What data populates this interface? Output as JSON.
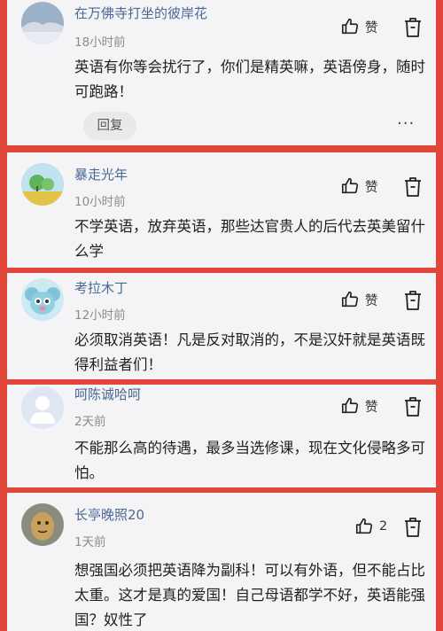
{
  "comments": [
    {
      "username": "在万佛寺打坐的彼岸花",
      "time": "18小时前",
      "content": "英语有你等会扰行了，你们是精英嘛，英语傍身，随时可跑路！",
      "like_label": "赞",
      "reply_label": "回复",
      "more_label": "···"
    },
    {
      "username": "暴走光年",
      "time": "10小时前",
      "content": "不学英语，放弃英语，那些达官贵人的后代去英美留什么学",
      "like_label": "赞"
    },
    {
      "username": "考拉木丁",
      "time": "12小时前",
      "content": "必须取消英语！凡是反对取消的，不是汉奸就是英语既得利益者们！",
      "like_label": "赞"
    },
    {
      "username": "呵陈诚哈呵",
      "time": "2天前",
      "content": "不能那么高的待遇，最多当选修课，现在文化侵略多可怕。",
      "like_label": "赞"
    },
    {
      "username": "长亭晚照20",
      "time": "1天前",
      "content": "想强国必须把英语降为副科！可以有外语，但不能占比太重。这才是真的爱国！自己母语都学不好，英语能强国？奴性了",
      "like_label": "2"
    }
  ],
  "colors": {
    "frame": "#e2473c",
    "card": "#f4f4f6",
    "username": "#4a6893"
  },
  "icons": [
    "thumbs-up-icon",
    "trash-icon"
  ]
}
